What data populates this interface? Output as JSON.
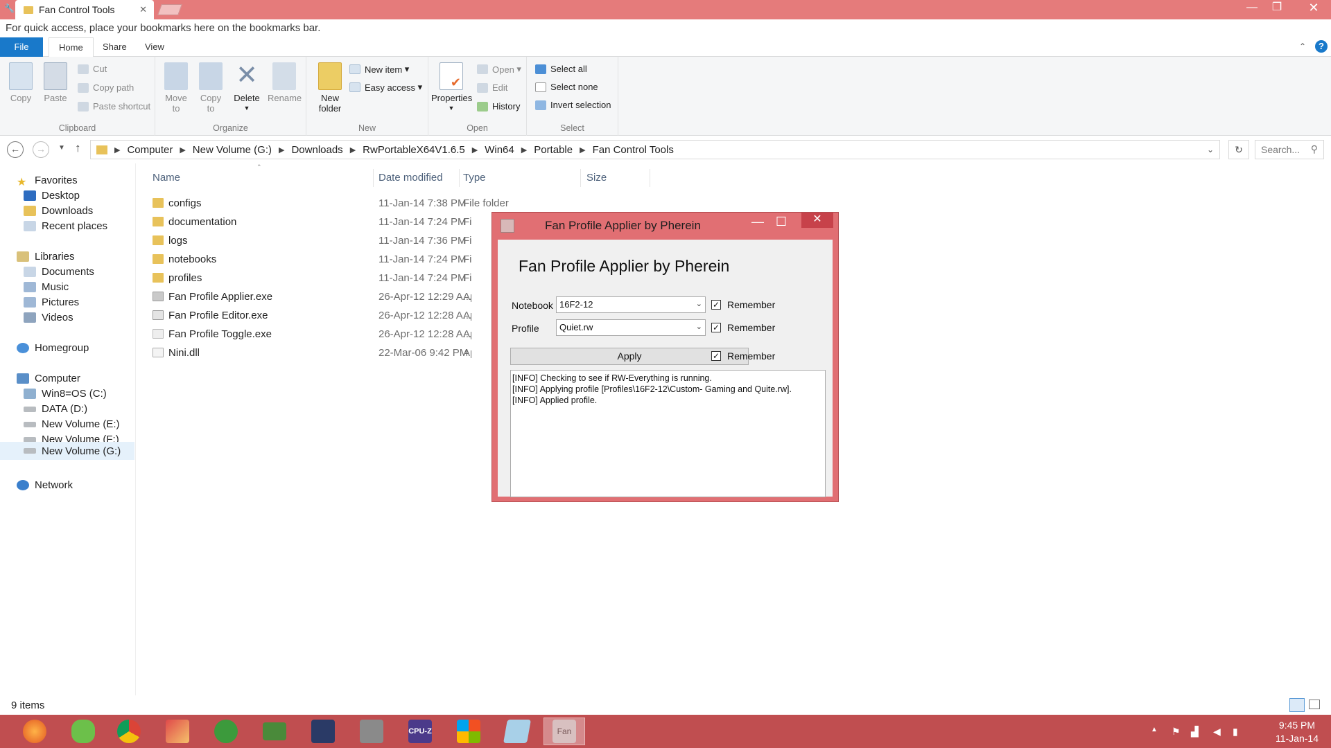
{
  "browser": {
    "tab_title": "Fan Control Tools",
    "bookmarks_hint": "For quick access, place your bookmarks here on the bookmarks bar."
  },
  "ribbon": {
    "tabs": [
      "File",
      "Home",
      "Share",
      "View"
    ],
    "clipboard": {
      "label": "Clipboard",
      "copy": "Copy",
      "paste": "Paste",
      "cut": "Cut",
      "copy_path": "Copy path",
      "paste_shortcut": "Paste shortcut"
    },
    "organize": {
      "label": "Organize",
      "move_to_1": "Move",
      "move_to_2": "to",
      "copy_to_1": "Copy",
      "copy_to_2": "to",
      "delete": "Delete",
      "rename": "Rename"
    },
    "new": {
      "label": "New",
      "new_folder_1": "New",
      "new_folder_2": "folder",
      "new_item": "New item",
      "easy_access": "Easy access"
    },
    "open": {
      "label": "Open",
      "properties": "Properties",
      "open": "Open",
      "edit": "Edit",
      "history": "History"
    },
    "select": {
      "label": "Select",
      "select_all": "Select all",
      "select_none": "Select none",
      "invert_selection": "Invert selection"
    }
  },
  "address": {
    "crumbs": [
      "Computer",
      "New Volume (G:)",
      "Downloads",
      "RwPortableX64V1.6.5",
      "Win64",
      "Portable",
      "Fan Control Tools"
    ],
    "search_placeholder": "Search..."
  },
  "nav": {
    "favorites": "Favorites",
    "desktop": "Desktop",
    "downloads": "Downloads",
    "recent": "Recent places",
    "libraries": "Libraries",
    "documents": "Documents",
    "music": "Music",
    "pictures": "Pictures",
    "videos": "Videos",
    "homegroup": "Homegroup",
    "computer": "Computer",
    "c": "Win8=OS (C:)",
    "d": "DATA (D:)",
    "e": "New Volume (E:)",
    "f": "New Volume (F:)",
    "g": "New Volume (G:)",
    "network": "Network"
  },
  "columns": {
    "name": "Name",
    "date": "Date modified",
    "type": "Type",
    "size": "Size"
  },
  "files": [
    {
      "name": "configs",
      "date": "11-Jan-14 7:38 PM",
      "type": "File folder"
    },
    {
      "name": "documentation",
      "date": "11-Jan-14 7:24 PM",
      "type": "Fi"
    },
    {
      "name": "logs",
      "date": "11-Jan-14 7:36 PM",
      "type": "Fi"
    },
    {
      "name": "notebooks",
      "date": "11-Jan-14 7:24 PM",
      "type": "Fi"
    },
    {
      "name": "profiles",
      "date": "11-Jan-14 7:24 PM",
      "type": "Fi"
    },
    {
      "name": "Fan Profile Applier.exe",
      "date": "26-Apr-12 12:29 A...",
      "type": "Ap"
    },
    {
      "name": "Fan Profile Editor.exe",
      "date": "26-Apr-12 12:28 A...",
      "type": "Ap"
    },
    {
      "name": "Fan Profile Toggle.exe",
      "date": "26-Apr-12 12:28 A...",
      "type": "Ap"
    },
    {
      "name": "Nini.dll",
      "date": "22-Mar-06 9:42 PM",
      "type": "Ap"
    }
  ],
  "status": {
    "items": "9 items"
  },
  "dialog": {
    "title": "Fan Profile Applier by Pherein",
    "heading": "Fan Profile Applier by Pherein",
    "notebook_label": "Notebook",
    "notebook_value": "16F2-12",
    "profile_label": "Profile",
    "profile_value": "Quiet.rw",
    "remember": "Remember",
    "apply": "Apply",
    "log": [
      "[INFO] Checking to see if RW-Everything is running.",
      "[INFO] Applying profile [Profiles\\16F2-12\\Custom- Gaming  and Quite.rw].",
      "[INFO] Applied profile."
    ]
  },
  "taskbar": {
    "time": "9:45 PM",
    "date": "11-Jan-14",
    "cpuz_label": "CPU-Z",
    "fan_label": "Fan"
  },
  "colors": {
    "titlebar": "#e57b7b",
    "taskbar": "#c04e50",
    "dialog_frame": "#e16f73",
    "accent": "#1979ca"
  }
}
